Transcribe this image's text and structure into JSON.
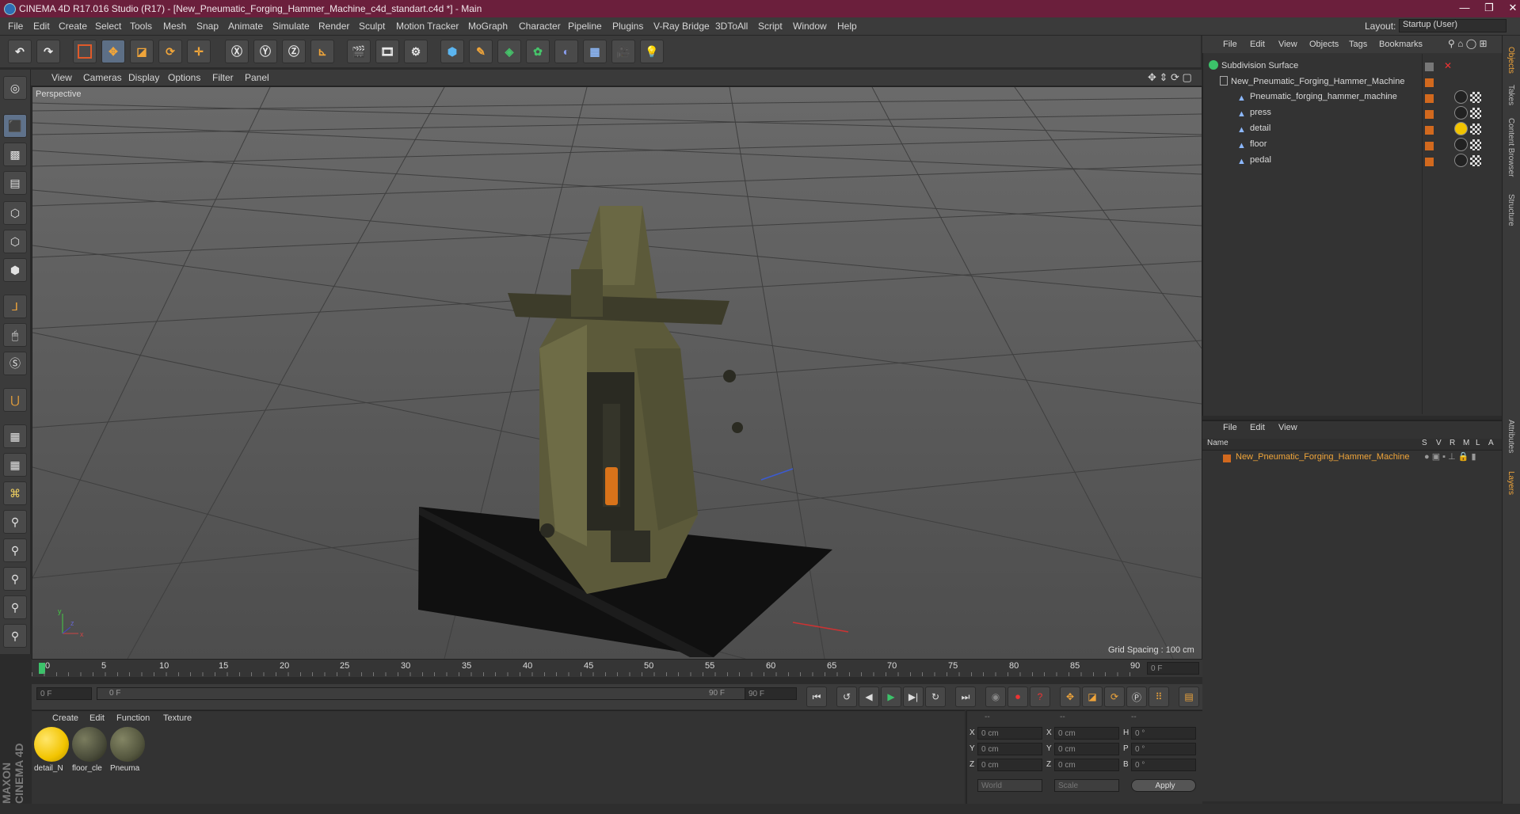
{
  "app": {
    "title": "CINEMA 4D R17.016 Studio (R17) - [New_Pneumatic_Forging_Hammer_Machine_c4d_standart.c4d *] - Main",
    "layout_label": "Layout:",
    "layout_value": "Startup (User)"
  },
  "menu": [
    "File",
    "Edit",
    "Create",
    "Select",
    "Tools",
    "Mesh",
    "Snap",
    "Animate",
    "Simulate",
    "Render",
    "Sculpt",
    "Motion Tracker",
    "MoGraph",
    "Character",
    "Pipeline",
    "Plugins",
    "V-Ray Bridge",
    "3DToAll",
    "Script",
    "Window",
    "Help"
  ],
  "viewport": {
    "menu": [
      "View",
      "Cameras",
      "Display",
      "Options",
      "Filter",
      "Panel"
    ],
    "label": "Perspective",
    "grid_spacing": "Grid Spacing : 100 cm"
  },
  "objects": {
    "menu": [
      "File",
      "Edit",
      "View",
      "Objects",
      "Tags",
      "Bookmarks"
    ],
    "items": [
      {
        "name": "Subdivision Surface",
        "indent": 0
      },
      {
        "name": "New_Pneumatic_Forging_Hammer_Machine",
        "indent": 1
      },
      {
        "name": "Pneumatic_forging_hammer_machine",
        "indent": 2
      },
      {
        "name": "press",
        "indent": 2
      },
      {
        "name": "detail",
        "indent": 2
      },
      {
        "name": "floor",
        "indent": 2
      },
      {
        "name": "pedal",
        "indent": 2
      }
    ]
  },
  "side_tabs": [
    "Objects",
    "Takes",
    "Content Browser",
    "Structure",
    "Attributes",
    "Layers"
  ],
  "layers": {
    "menu": [
      "File",
      "Edit",
      "View"
    ],
    "columns": [
      "Name",
      "S",
      "V",
      "R",
      "M",
      "L",
      "A"
    ],
    "row": "New_Pneumatic_Forging_Hammer_Machine"
  },
  "timeline": {
    "ticks": [
      "0",
      "5",
      "10",
      "15",
      "20",
      "25",
      "30",
      "35",
      "40",
      "45",
      "50",
      "55",
      "60",
      "65",
      "70",
      "75",
      "80",
      "85",
      "90"
    ],
    "current_frame": "0 F",
    "start_field": "0 F",
    "range_start": "0 F",
    "range_end": "90 F",
    "end_field": "90 F"
  },
  "materials": {
    "menu": [
      "Create",
      "Edit",
      "Function",
      "Texture"
    ],
    "items": [
      {
        "label": "detail_N",
        "color": "#f2c400"
      },
      {
        "label": "floor_cle",
        "color": "#4a4c3a"
      },
      {
        "label": "Pneuma",
        "color": "#55573f"
      }
    ]
  },
  "coords": {
    "header": [
      "--",
      "--",
      "--"
    ],
    "rows": [
      {
        "a": "X",
        "av": "0 cm",
        "b": "X",
        "bv": "0 cm",
        "c": "H",
        "cv": "0 °"
      },
      {
        "a": "Y",
        "av": "0 cm",
        "b": "Y",
        "bv": "0 cm",
        "c": "P",
        "cv": "0 °"
      },
      {
        "a": "Z",
        "av": "0 cm",
        "b": "Z",
        "bv": "0 cm",
        "c": "B",
        "cv": "0 °"
      }
    ],
    "world": "World",
    "scale": "Scale",
    "apply": "Apply"
  },
  "brand": "MAXON CINEMA 4D"
}
